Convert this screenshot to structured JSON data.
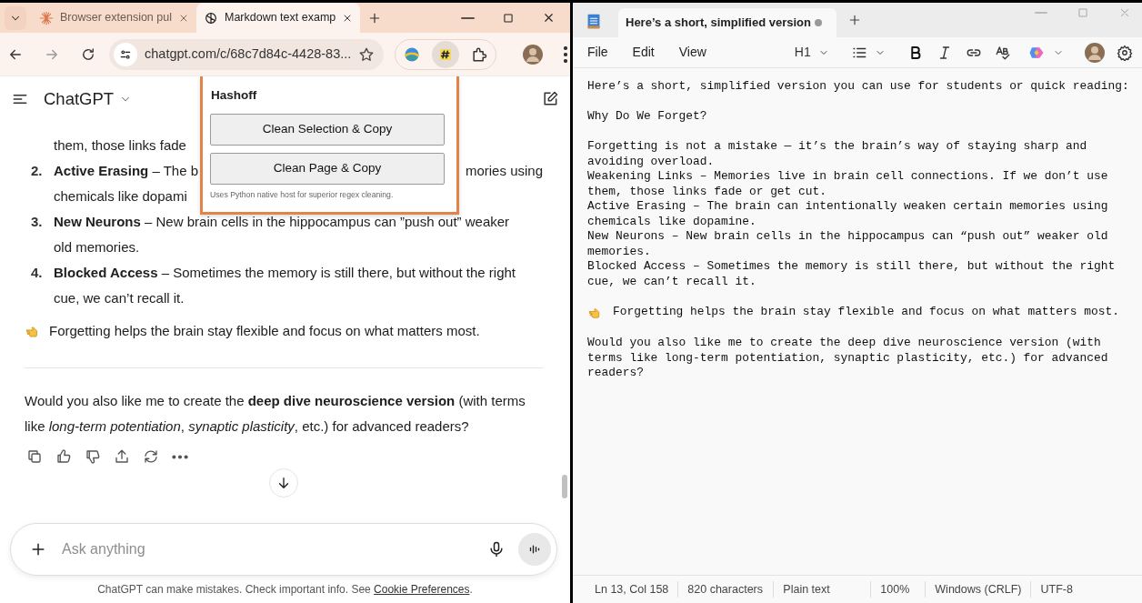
{
  "browser": {
    "tabs": [
      {
        "title": "Browser extension pul",
        "selected": false
      },
      {
        "title": "Markdown text examp",
        "selected": true
      }
    ],
    "address": "chatgpt.com/c/68c7d84c-4428-83..."
  },
  "chat": {
    "title": "ChatGPT",
    "items": [
      {
        "lines": [
          {
            "left": "them, those links fade"
          }
        ]
      },
      {
        "number": "2.",
        "lines": [
          {
            "left": "**Active Erasing** – The b",
            "right": "mories using"
          },
          {
            "left": "chemicals like dopami"
          }
        ]
      },
      {
        "number": "3.",
        "lines": [
          {
            "left": "**New Neurons** – New brain cells in the hippocampus can ”push out” weaker"
          },
          {
            "left": "old memories."
          }
        ]
      },
      {
        "number": "4.",
        "lines": [
          {
            "left": "**Blocked Access** – Sometimes the memory is still there, but without the right"
          },
          {
            "left": "cue, we can’t recall it."
          }
        ]
      }
    ],
    "closing": "Forgetting helps the brain stay flexible and focus on what matters most.",
    "question_lines": [
      "Would you also like me to create the **deep dive neuroscience version** (with terms",
      "like *long-term potentiation*, *synaptic plasticity*, etc.) for advanced readers?"
    ],
    "composer": {
      "placeholder": "Ask anything"
    },
    "disclaimer": {
      "text": "ChatGPT can make mistakes. Check important info. See",
      "link": "Cookie Preferences",
      "end": "."
    }
  },
  "extension_popup": {
    "title": "Hashoff",
    "buttons": [
      "Clean Selection & Copy",
      "Clean Page & Copy"
    ],
    "note": "Uses Python native host for superior regex cleaning."
  },
  "notepad": {
    "tab": {
      "title": "Here’s a short, simplified version",
      "unsaved": true
    },
    "menu": [
      "File",
      "Edit",
      "View"
    ],
    "heading_level": "H1",
    "paragraphs": [
      [
        "Here’s a short, simplified version you can use for students or quick reading:"
      ],
      [
        "Why Do We Forget?"
      ],
      [
        "Forgetting is not a mistake — it’s the brain’s way of staying sharp and avoiding overload.",
        "Weakening Links – Memories live in brain cell connections. If we don’t use them, those links fade or get cut.",
        "Active Erasing – The brain can intentionally weaken certain memories using chemicals like dopamine.",
        "New Neurons – New brain cells in the hippocampus can “push out” weaker old memories.",
        "Blocked Access – Sometimes the memory is still there, but without the right cue, we can’t recall it."
      ],
      [
        {
          "kind": "hand-line",
          "text": "Forgetting helps the brain stay flexible and focus on what matters most."
        }
      ],
      [
        "Would you also like me to create the deep dive neuroscience version (with terms like long-term potentiation, synaptic plasticity, etc.) for advanced readers?"
      ]
    ],
    "status_bar": [
      "Ln 13, Col 158",
      "820 characters",
      "Plain text",
      "100%",
      "Windows (CRLF)",
      "UTF-8"
    ]
  }
}
